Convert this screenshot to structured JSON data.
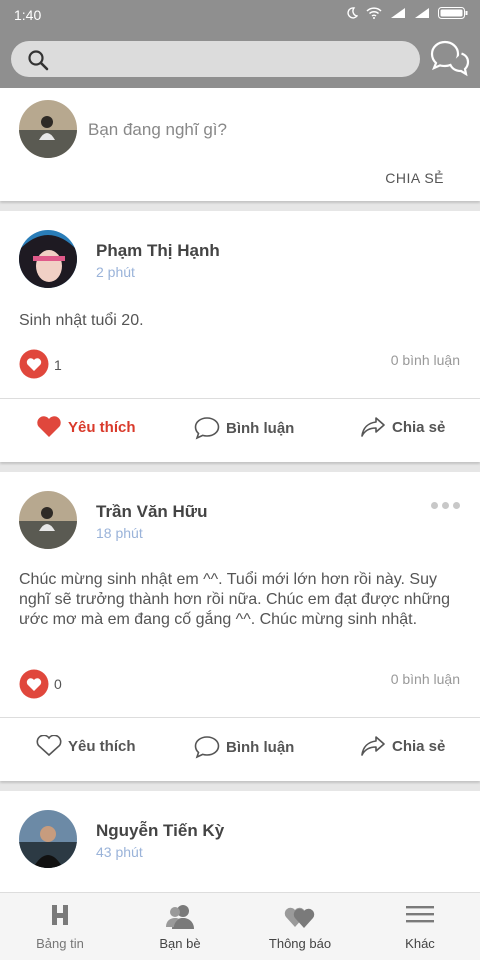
{
  "status": {
    "time": "1:40"
  },
  "search": {
    "placeholder": ""
  },
  "compose": {
    "prompt": "Bạn đang nghĩ gì?",
    "share_label": "CHIA SẺ"
  },
  "posts": [
    {
      "author": "Phạm Thị Hạnh",
      "time": "2 phút",
      "content": "Sinh nhật tuổi 20.",
      "likes": "1",
      "comments": "0 bình luận",
      "liked": true
    },
    {
      "author": "Trần Văn Hữu",
      "time": "18 phút",
      "content": "Chúc mừng sinh nhật em ^^. Tuổi mới lớn hơn rồi này. Suy nghĩ sẽ trưởng thành hơn rồi nữa. Chúc em đạt được những ước mơ mà em đang cố gắng ^^. Chúc mừng sinh nhật.",
      "likes": "0",
      "comments": "0 bình luận",
      "liked": false
    },
    {
      "author": "Nguyễn Tiến Kỳ",
      "time": "43 phút"
    }
  ],
  "actions": {
    "like": "Yêu thích",
    "comment": "Bình luận",
    "share": "Chia sẻ"
  },
  "tabs": [
    {
      "label": "Bảng tin",
      "icon": "news-feed-icon"
    },
    {
      "label": "Bạn bè",
      "icon": "friends-icon"
    },
    {
      "label": "Thông báo",
      "icon": "notifications-icon"
    },
    {
      "label": "Khác",
      "icon": "menu-icon"
    }
  ],
  "colors": {
    "accent_red": "#e0473c",
    "bar_gray": "#8f8f8f",
    "time_blue": "#9ab3d9"
  }
}
